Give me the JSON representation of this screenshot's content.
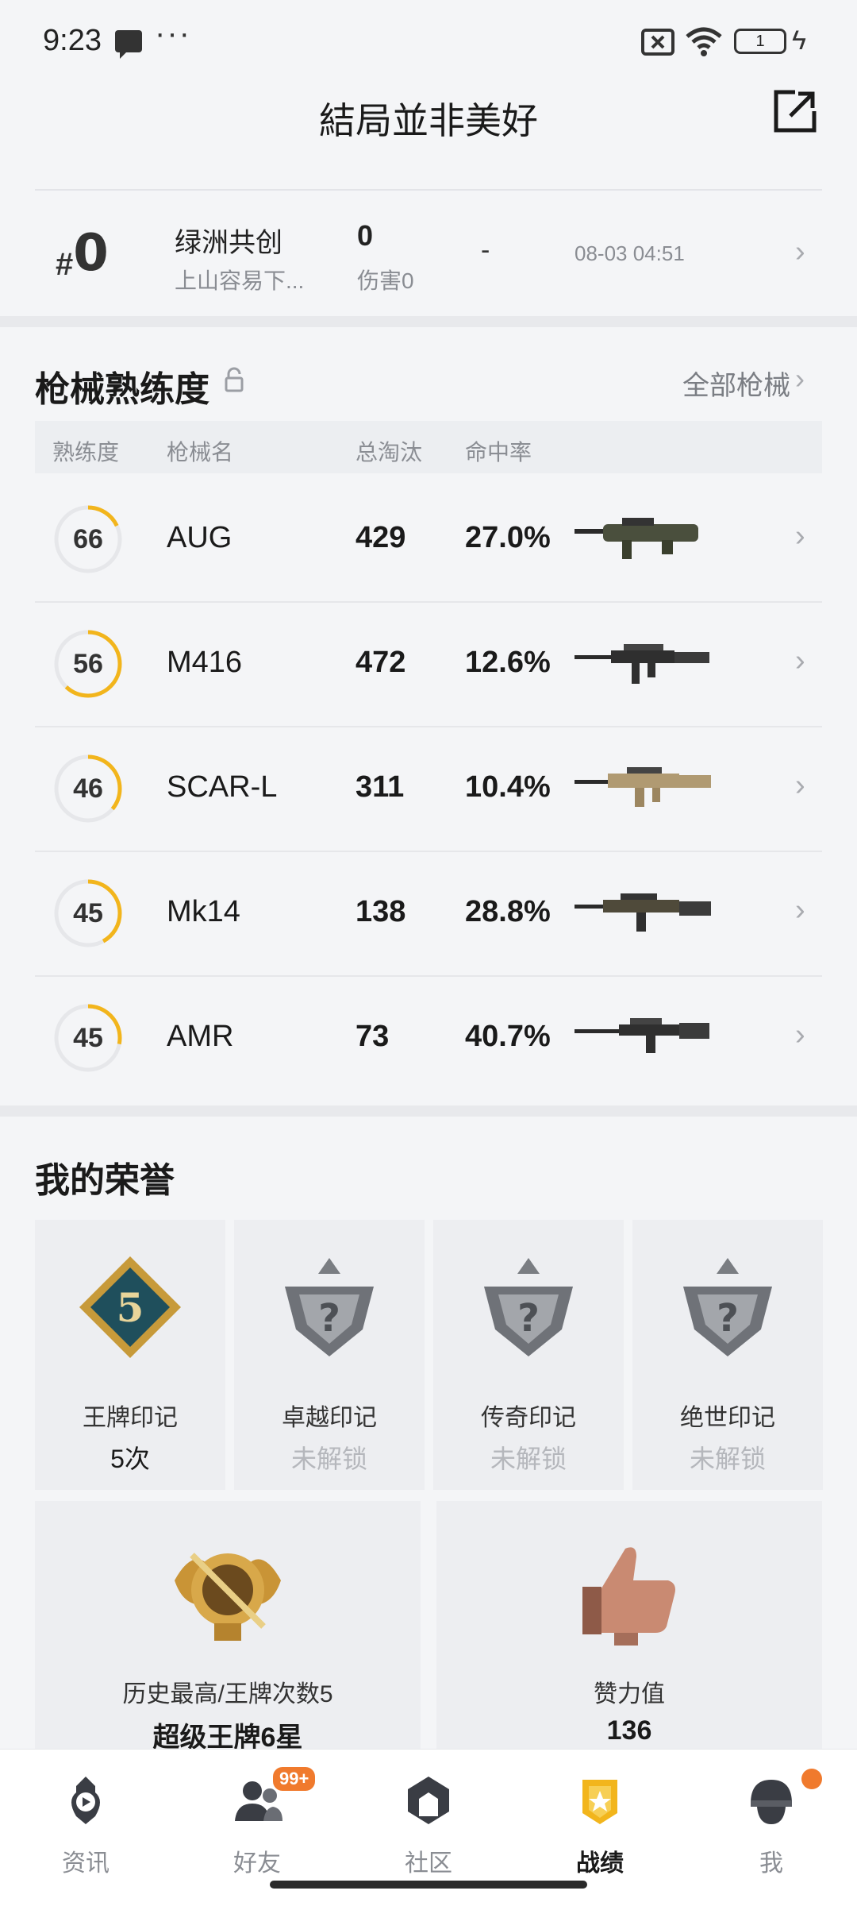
{
  "status_bar": {
    "time": "9:23",
    "battery_level": "1"
  },
  "header": {
    "title": "結局並非美好"
  },
  "match": {
    "rank_hash": "#",
    "rank_number": "0",
    "team_name": "绿洲共创",
    "team_sub": "上山容易下...",
    "kills": "0",
    "damage": "伤害0",
    "dash": "-",
    "time": "08-03 04:51"
  },
  "weapons": {
    "title": "枪械熟练度",
    "all_label": "全部枪械",
    "columns": [
      "熟练度",
      "枪械名",
      "总淘汰",
      "命中率"
    ],
    "rows": [
      {
        "level": "66",
        "name": "AUG",
        "kills": "429",
        "rate": "27.0%",
        "progress": 0.18
      },
      {
        "level": "56",
        "name": "M416",
        "kills": "472",
        "rate": "12.6%",
        "progress": 0.62
      },
      {
        "level": "46",
        "name": "SCAR-L",
        "kills": "311",
        "rate": "10.4%",
        "progress": 0.36
      },
      {
        "level": "45",
        "name": "Mk14",
        "kills": "138",
        "rate": "28.8%",
        "progress": 0.42
      },
      {
        "level": "45",
        "name": "AMR",
        "kills": "73",
        "rate": "40.7%",
        "progress": 0.28
      }
    ]
  },
  "honors": {
    "title": "我的荣誉",
    "cards": [
      {
        "name": "王牌印记",
        "value": "5次",
        "badge_text": "5"
      },
      {
        "name": "卓越印记",
        "value": "未解锁",
        "badge_text": "?"
      },
      {
        "name": "传奇印记",
        "value": "未解锁",
        "badge_text": "?"
      },
      {
        "name": "绝世印记",
        "value": "未解锁",
        "badge_text": "?"
      }
    ],
    "big_cards": [
      {
        "name": "历史最高/王牌次数5",
        "value": "超级王牌6星"
      },
      {
        "name": "赞力值",
        "value": "136"
      }
    ]
  },
  "bottom_nav": {
    "items": [
      {
        "label": "资讯",
        "icon": "news-icon"
      },
      {
        "label": "好友",
        "icon": "friends-icon",
        "badge": "99+"
      },
      {
        "label": "社区",
        "icon": "community-icon"
      },
      {
        "label": "战绩",
        "icon": "record-icon",
        "active": true
      },
      {
        "label": "我",
        "icon": "profile-icon"
      }
    ]
  },
  "colors": {
    "accent_yellow": "#f2b51c",
    "badge_orange": "#f07a2d"
  }
}
